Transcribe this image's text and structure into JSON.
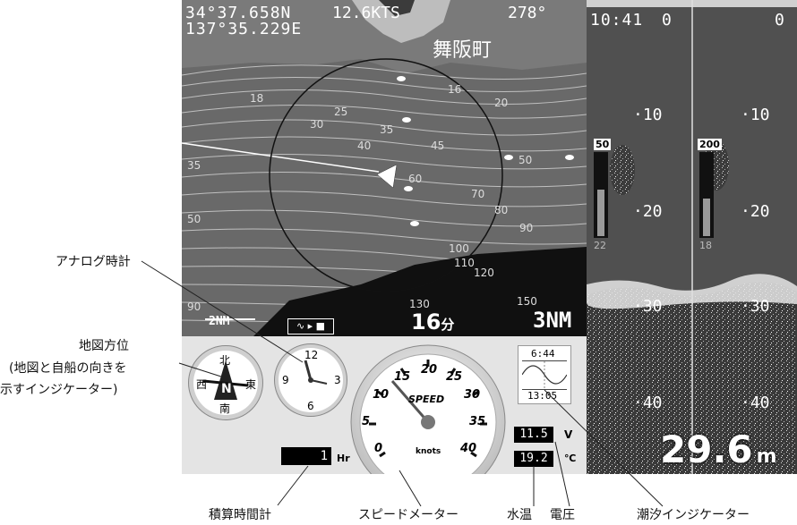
{
  "map": {
    "position_lat": "34°37.658N",
    "position_lon": "137°35.229E",
    "speed": "12.6KTS",
    "heading": "278°",
    "place_name": "舞阪町",
    "scale_left": "2NM",
    "timer_value": "16",
    "timer_unit": "分",
    "range": "3NM",
    "contour_labels": [
      "18",
      "25",
      "30",
      "35",
      "40",
      "45",
      "50",
      "60",
      "70",
      "80",
      "90",
      "100",
      "110",
      "120",
      "130",
      "150",
      "16",
      "20",
      "35",
      "50",
      "90"
    ]
  },
  "sonar": {
    "left_time": "10:41",
    "left_top_depth": "0",
    "right_top_depth": "0",
    "depth_ticks": [
      "10",
      "20",
      "30",
      "40"
    ],
    "left_freq": "50",
    "right_freq": "200",
    "left_gain": "22",
    "right_gain": "18",
    "depth_reading": "29.6",
    "depth_unit": "m"
  },
  "instruments": {
    "compass": {
      "north": "北",
      "south": "南",
      "east": "東",
      "west": "西",
      "marker": "N"
    },
    "clock": {
      "n12": "12",
      "n3": "3",
      "n6": "6",
      "n9": "9"
    },
    "speedometer": {
      "label": "SPEED",
      "unit": "knots",
      "ticks": [
        "0",
        "5",
        "10",
        "15",
        "20",
        "25",
        "30",
        "35",
        "40"
      ]
    },
    "tide": {
      "high_time": "6:44",
      "low_time": "13:05"
    },
    "voltage": {
      "value": "11.5",
      "unit": "V"
    },
    "water_temp": {
      "value": "19.2",
      "unit": "℃"
    },
    "hour_meter": {
      "value": "1",
      "unit": "Hr"
    }
  },
  "callouts": {
    "analog_clock": "アナログ時計",
    "map_orientation_title": "地図方位",
    "map_orientation_desc1": "(地図と自船の向きを",
    "map_orientation_desc2": "示すインジケーター)",
    "hour_meter": "積算時間計",
    "speedometer": "スピードメーター",
    "water_temp": "水温",
    "voltage": "電圧",
    "tide_indicator": "潮汐インジケーター"
  },
  "colors": {
    "map_bg": "#6b6b6b",
    "land": "#101010",
    "sonar_bg": "#4a4a4a",
    "panel_bg": "#e4e4e4"
  }
}
